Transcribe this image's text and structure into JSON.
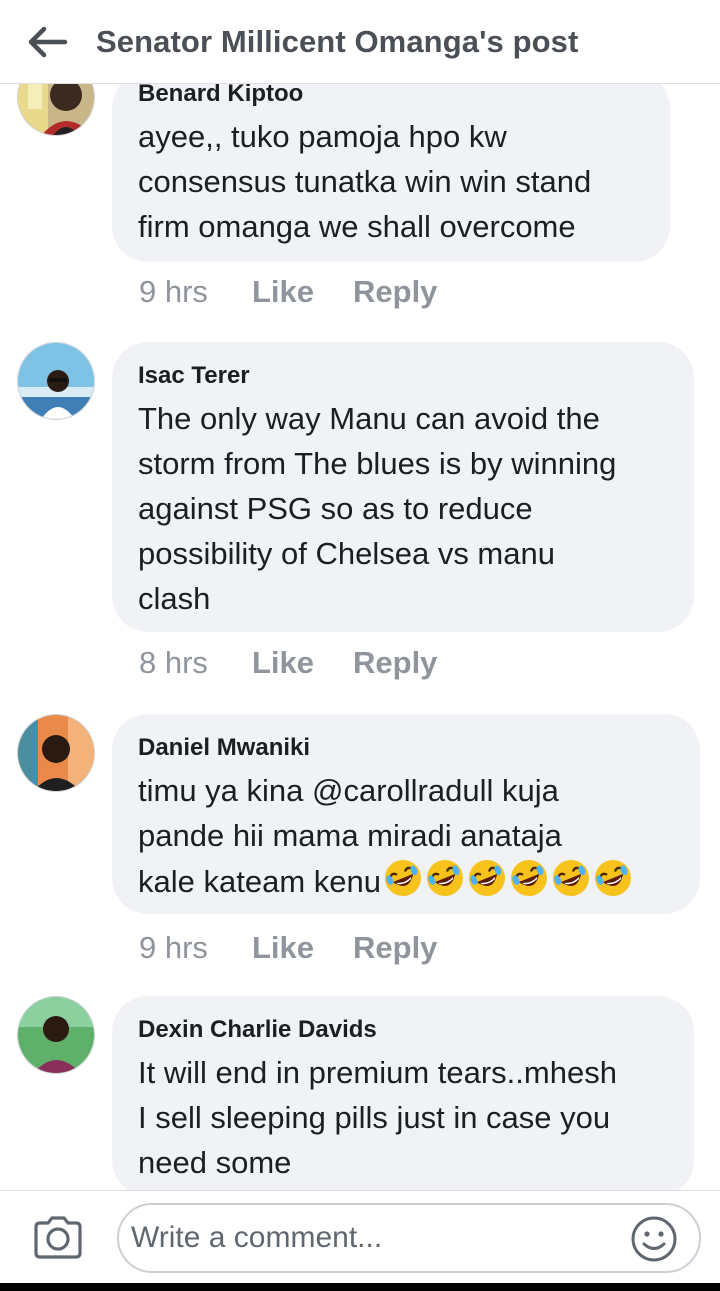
{
  "header": {
    "title": "Senator Millicent Omanga's post",
    "back_icon": "arrow-left-icon"
  },
  "comments": [
    {
      "author": "Benard Kiptoo",
      "lines": [
        "ayee,, tuko pamoja hpo kw",
        "consensus tunatka win win stand",
        "firm omanga we shall overcome"
      ],
      "time": "9 hrs",
      "like": "Like",
      "reply": "Reply"
    },
    {
      "author": "Isac Terer",
      "lines": [
        "The only way Manu can avoid the",
        "storm from The blues is by winning",
        "against PSG so as to reduce",
        "possibility of Chelsea vs manu",
        "clash"
      ],
      "time": "8 hrs",
      "like": "Like",
      "reply": "Reply"
    },
    {
      "author": "Daniel Mwaniki",
      "lines": [
        "timu ya kina @carollradull kuja",
        "pande hii mama miradi anataja",
        "kale kateam kenu"
      ],
      "emoji_count_label": "6",
      "emoji_icon": "rolling-on-floor-laughing-emoji",
      "time": "9 hrs",
      "like": "Like",
      "reply": "Reply"
    },
    {
      "author": "Dexin Charlie Davids",
      "lines": [
        "It will end in premium tears..mhesh",
        "I sell sleeping pills just in case you",
        "need some"
      ]
    }
  ],
  "composer": {
    "placeholder": "Write a comment...",
    "camera_icon": "camera-icon",
    "emoji_icon": "smiley-icon"
  },
  "colors": {
    "bubble": "#f0f2f5",
    "muted_text": "#90949c",
    "header_text": "#4b4f56"
  }
}
